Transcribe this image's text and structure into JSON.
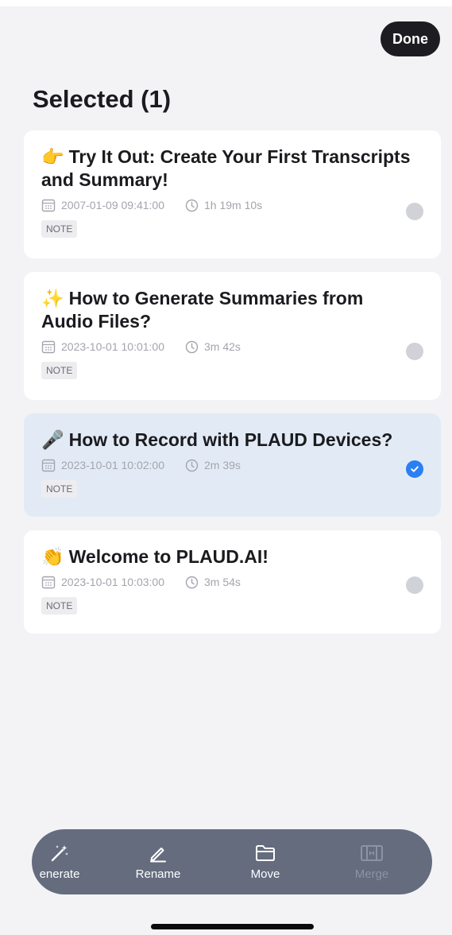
{
  "header": {
    "done_label": "Done",
    "title": "Selected (1)"
  },
  "cards": [
    {
      "emoji": "👉",
      "title": "Try It Out: Create Your First Transcripts and Summary!",
      "date": "2007-01-09 09:41:00",
      "duration": "1h 19m 10s",
      "tag": "NOTE",
      "selected": false
    },
    {
      "emoji": "✨",
      "title": "How to Generate Summaries from Audio Files?",
      "date": "2023-10-01 10:01:00",
      "duration": "3m 42s",
      "tag": "NOTE",
      "selected": false
    },
    {
      "emoji": "🎤",
      "title": "How to Record with PLAUD Devices?",
      "date": "2023-10-01 10:02:00",
      "duration": "2m 39s",
      "tag": "NOTE",
      "selected": true
    },
    {
      "emoji": "👏",
      "title": "Welcome to PLAUD.AI!",
      "date": "2023-10-01 10:03:00",
      "duration": "3m 54s",
      "tag": "NOTE",
      "selected": false
    }
  ],
  "toolbar": {
    "generate_label": "enerate",
    "rename_label": "Rename",
    "move_label": "Move",
    "merge_label": "Merge"
  },
  "colors": {
    "accent": "#2a7ff5",
    "selected_bg": "#e2ebf5",
    "toolbar_bg": "#646c7e"
  },
  "icons": [
    "calendar-icon",
    "clock-icon",
    "magic-wand-icon",
    "pencil-icon",
    "folder-icon",
    "merge-icon",
    "check-icon"
  ]
}
